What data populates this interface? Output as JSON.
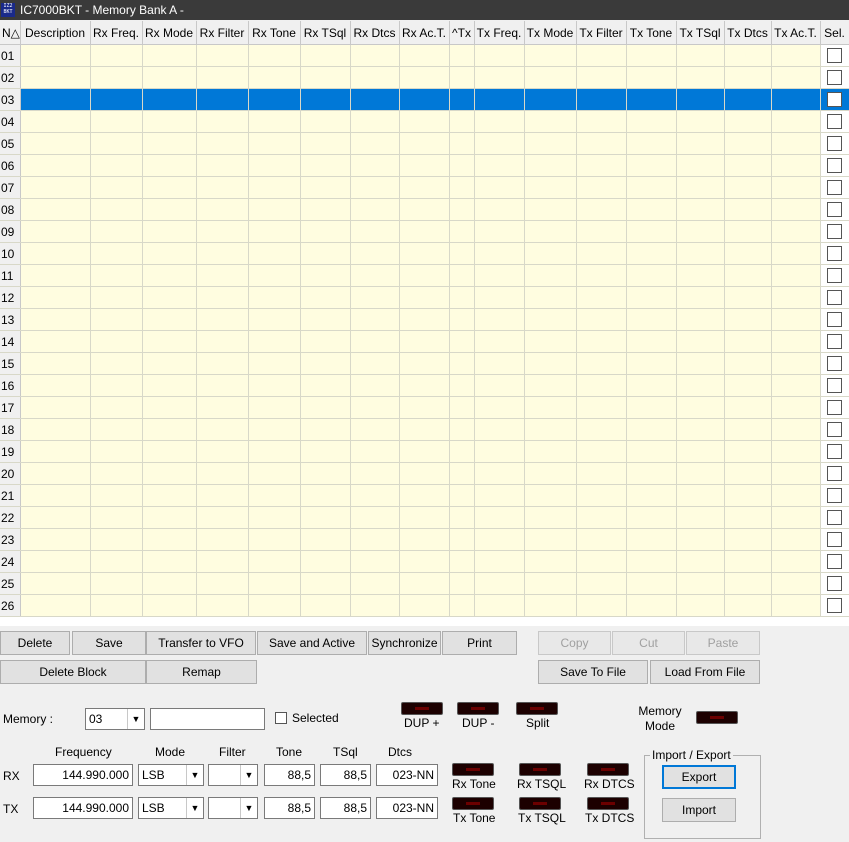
{
  "window": {
    "icon_text": "IZ2 BKT",
    "title": "IC7000BKT - Memory Bank A -"
  },
  "grid": {
    "columns": [
      "N△",
      "Description",
      "Rx Freq.",
      "Rx Mode",
      "Rx Filter",
      "Rx Tone",
      "Rx TSql",
      "Rx Dtcs",
      "Rx Ac.T.",
      "^Tx",
      "Tx Freq.",
      "Tx Mode",
      "Tx Filter",
      "Tx Tone",
      "Tx TSql",
      "Tx Dtcs",
      "Tx Ac.T.",
      "Sel."
    ],
    "rows": [
      "01",
      "02",
      "03",
      "04",
      "05",
      "06",
      "07",
      "08",
      "09",
      "10",
      "11",
      "12",
      "13",
      "14",
      "15",
      "16",
      "17",
      "18",
      "19",
      "20",
      "21",
      "22",
      "23",
      "24",
      "25",
      "26"
    ],
    "selected_row": "03"
  },
  "buttons": {
    "delete": "Delete",
    "save": "Save",
    "transfer_vfo": "Transfer to VFO",
    "save_active": "Save and Active",
    "synchronize": "Synchronize",
    "print": "Print",
    "copy": "Copy",
    "cut": "Cut",
    "paste": "Paste",
    "delete_block": "Delete  Block",
    "remap": "Remap",
    "save_to_file": "Save To File",
    "load_from_file": "Load From File",
    "export": "Export",
    "import": "Import"
  },
  "memory": {
    "label": "Memory :",
    "value": "03",
    "name": "",
    "selected_label": "Selected",
    "selected": false
  },
  "indicators": {
    "dup_plus": "DUP +",
    "dup_minus": "DUP -",
    "split": "Split",
    "memory_mode": "Memory Mode",
    "rx_tone": "Rx Tone",
    "rx_tsql": "Rx TSQL",
    "rx_dtcs": "Rx DTCS",
    "tx_tone": "Tx Tone",
    "tx_tsql": "Tx TSQL",
    "tx_dtcs": "Tx DTCS"
  },
  "fields": {
    "headers": {
      "frequency": "Frequency",
      "mode": "Mode",
      "filter": "Filter",
      "tone": "Tone",
      "tsql": "TSql",
      "dtcs": "Dtcs"
    },
    "rx": {
      "label": "RX",
      "frequency": "144.990.000",
      "mode": "LSB",
      "filter": "",
      "tone": "88,5",
      "tsql": "88,5",
      "dtcs": "023-NN"
    },
    "tx": {
      "label": "TX",
      "frequency": "144.990.000",
      "mode": "LSB",
      "filter": "",
      "tone": "88,5",
      "tsql": "88,5",
      "dtcs": "023-NN"
    }
  },
  "import_export": {
    "title": "Import / Export"
  },
  "colors": {
    "grid_bg": "#fffde0",
    "selection": "#0078d7",
    "led_off": "#1c0000"
  }
}
